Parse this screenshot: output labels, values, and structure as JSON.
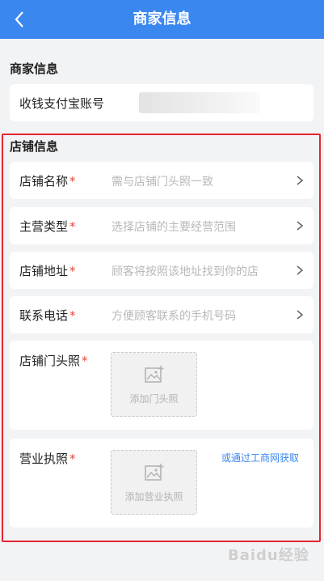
{
  "navbar": {
    "title": "商家信息",
    "back_icon": "chevron-left-icon"
  },
  "merchant": {
    "section_title": "商家信息",
    "alipay_label": "收钱支付宝账号"
  },
  "store": {
    "section_title": "店铺信息",
    "fields": [
      {
        "label": "店铺名称",
        "required": "*",
        "placeholder": "需与店铺门头照一致"
      },
      {
        "label": "主营类型",
        "required": "*",
        "placeholder": "选择店铺的主要经营范围"
      },
      {
        "label": "店铺地址",
        "required": "*",
        "placeholder": "顾客将按照该地址找到你的店"
      },
      {
        "label": "联系电话",
        "required": "*",
        "placeholder": "方便顾客联系的手机号码"
      }
    ],
    "storefront": {
      "label": "店铺门头照",
      "required": "*",
      "upload_label": "添加门头照"
    },
    "license": {
      "label": "营业执照",
      "required": "*",
      "upload_label": "添加营业执照",
      "link": "或通过工商网获取"
    }
  },
  "watermark": "Baidu经验",
  "colors": {
    "accent": "#3b87f0",
    "required": "#e5493f",
    "highlight_border": "#e4262f"
  }
}
